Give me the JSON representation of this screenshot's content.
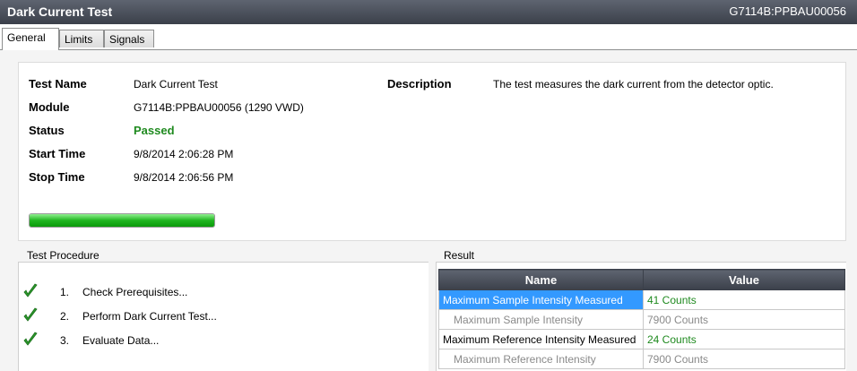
{
  "titlebar": {
    "title": "Dark Current Test",
    "module_id": "G7114B:PPBAU00056"
  },
  "tabs": [
    "General",
    "Limits",
    "Signals"
  ],
  "info": {
    "test_name_label": "Test Name",
    "test_name": "Dark Current Test",
    "module_label": "Module",
    "module": "G7114B:PPBAU00056 (1290 VWD)",
    "status_label": "Status",
    "status": "Passed",
    "start_label": "Start Time",
    "start": "9/8/2014 2:06:28 PM",
    "stop_label": "Stop Time",
    "stop": "9/8/2014 2:06:56 PM",
    "description_label": "Description",
    "description": "The test measures the dark current from the detector optic.",
    "progress_fraction": 1.0
  },
  "procedure": {
    "title": "Test Procedure",
    "steps": [
      {
        "num": "1.",
        "text": "Check Prerequisites..."
      },
      {
        "num": "2.",
        "text": "Perform Dark Current Test..."
      },
      {
        "num": "3.",
        "text": "Evaluate Data..."
      }
    ]
  },
  "result": {
    "title": "Result",
    "headers": [
      "Name",
      "Value"
    ],
    "rows": [
      {
        "name": "Maximum Sample Intensity Measured",
        "value": "41 Counts"
      },
      {
        "name": "Maximum Sample Intensity",
        "value": "7900 Counts"
      },
      {
        "name": "Maximum Reference Intensity Measured",
        "value": "24 Counts"
      },
      {
        "name": "Maximum Reference Intensity",
        "value": "7900 Counts"
      }
    ]
  },
  "colors": {
    "pass_green": "#1f8a1f",
    "selection_blue": "#3399ff",
    "header_dark": "#3b404a"
  }
}
